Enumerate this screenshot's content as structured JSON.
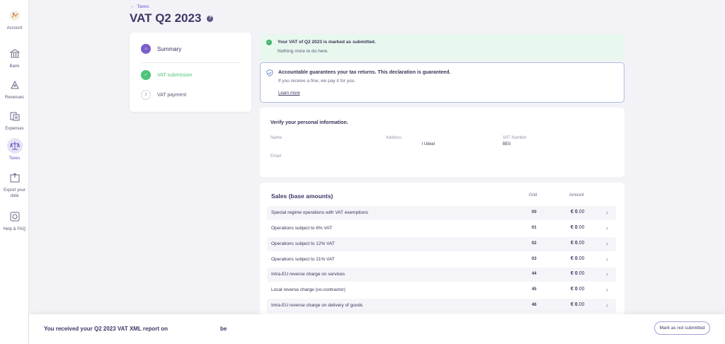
{
  "sidebar": {
    "items": [
      {
        "label": "Account"
      },
      {
        "label": "Bank"
      },
      {
        "label": "Revenues"
      },
      {
        "label": "Expenses"
      },
      {
        "label": "Taxes"
      },
      {
        "label": "Export your data"
      },
      {
        "label": "Help & FAQ"
      }
    ]
  },
  "header": {
    "back_label": "Taxes",
    "title": "VAT Q2 2023",
    "help_glyph": "?"
  },
  "steps": {
    "summary": "Summary",
    "vat_submission": "VAT submission",
    "vat_payment": "VAT payment",
    "vat_payment_number": "2"
  },
  "notice_success": {
    "title": "Your VAT of Q2 2023 is marked as submitted.",
    "subtitle": "Nothing more to do here."
  },
  "notice_guarantee": {
    "title": "Accountable guarantees your tax returns. This declaration is guaranteed.",
    "subtitle": "If you receive a fine, we pay it for you.",
    "link": "Learn more"
  },
  "personal_info": {
    "title": "Verify your personal information.",
    "name_label": "Name",
    "address_label": "Address",
    "address_value": "l Ukkel",
    "vat_label": "VAT Number",
    "vat_value": "BE0",
    "email_label": "Email"
  },
  "sales": {
    "title": "Sales (base amounts)",
    "grid_header": "Grid",
    "amount_header": "Amount",
    "currency": "€",
    "rows": [
      {
        "desc": "Special regime operations with VAT exemptions",
        "grid": "00",
        "amount_int": "0",
        "amount_dec": ".00"
      },
      {
        "desc": "Operations subject to 6% VAT",
        "grid": "01",
        "amount_int": "0",
        "amount_dec": ".00"
      },
      {
        "desc": "Operations subject to 12% VAT",
        "grid": "02",
        "amount_int": "0",
        "amount_dec": ".00"
      },
      {
        "desc": "Operations subject to 21% VAT",
        "grid": "03",
        "amount_int": "0",
        "amount_dec": ".00"
      },
      {
        "desc": "Intra-EU reverse charge on services",
        "grid": "44",
        "amount_int": "0",
        "amount_dec": ".00"
      },
      {
        "desc": "Local reverse charge (co-contractor)",
        "grid": "45",
        "amount_int": "0",
        "amount_dec": ".00"
      },
      {
        "desc": "Intra-EU reverse charge on delivery of goods",
        "grid": "46",
        "amount_int": "0",
        "amount_dec": ".00"
      }
    ]
  },
  "bottom_bar": {
    "text_before": "You received your Q2 2023 VAT XML report on",
    "text_after": "be",
    "button": "Mark as not submitted"
  },
  "icons": {
    "account": "account-icon",
    "bank": "bank-icon",
    "revenues": "revenues-icon",
    "expenses": "expenses-icon",
    "taxes": "scales-icon",
    "export": "export-icon",
    "help": "lifebuoy-icon"
  },
  "colors": {
    "accent": "#6b55c6",
    "success": "#4ec47a",
    "success_bg": "#e9f8ee",
    "guarantee_border": "#a9bde6"
  }
}
